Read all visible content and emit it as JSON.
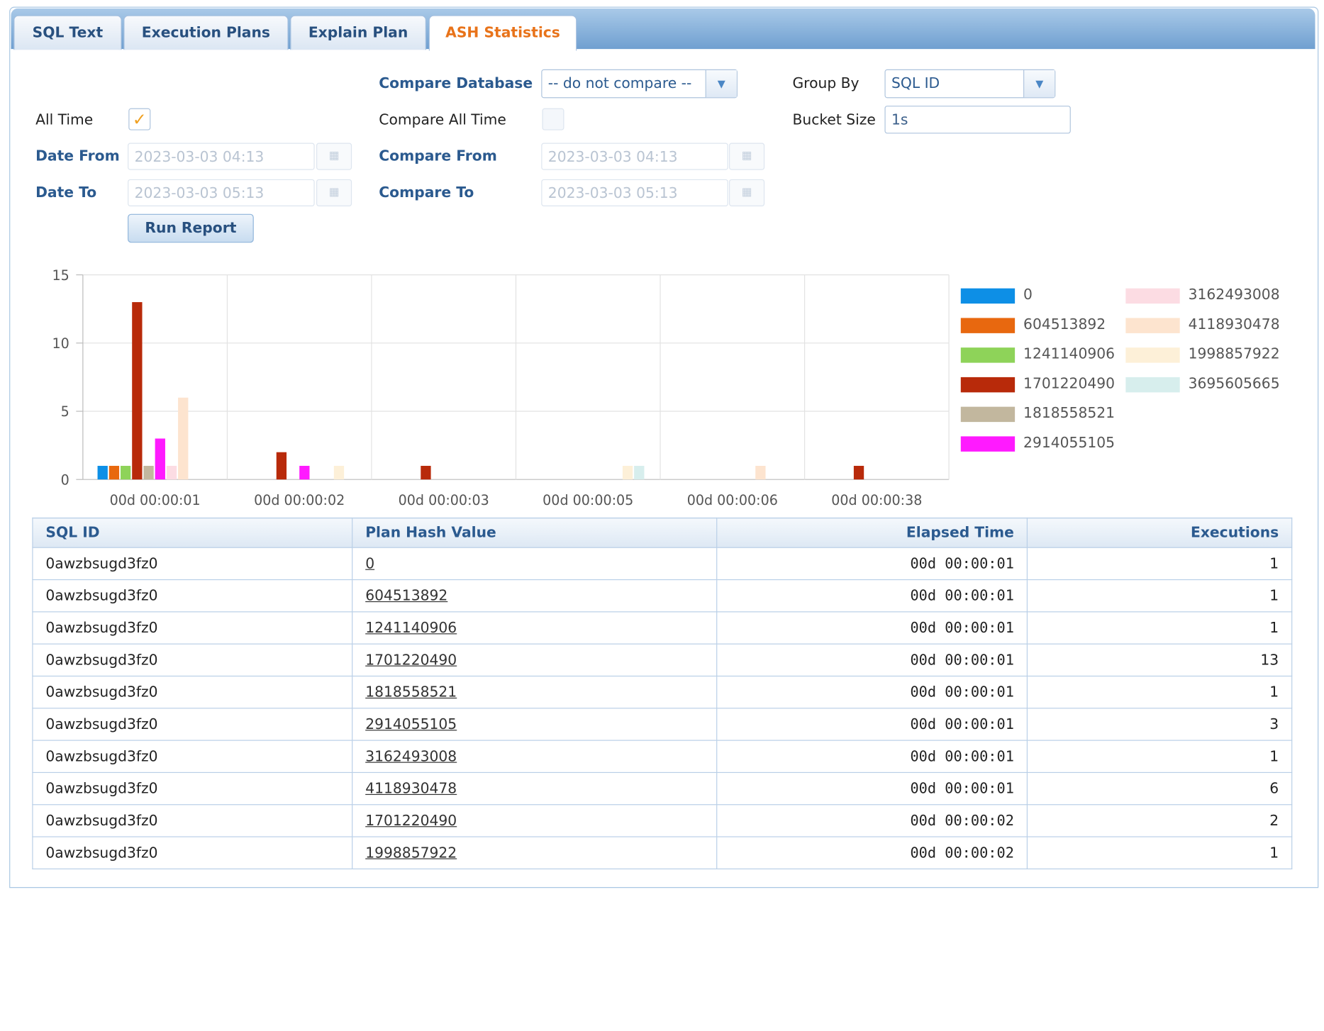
{
  "tabs": [
    {
      "label": "SQL Text"
    },
    {
      "label": "Execution Plans"
    },
    {
      "label": "Explain Plan"
    },
    {
      "label": "ASH Statistics"
    }
  ],
  "form": {
    "all_time_label": "All Time",
    "all_time_checked": true,
    "date_from_label": "Date From",
    "date_from_value": "2023-03-03 04:13",
    "date_to_label": "Date To",
    "date_to_value": "2023-03-03 05:13",
    "run_report_label": "Run Report",
    "compare_database_label": "Compare Database",
    "compare_database_value": "-- do not compare --",
    "compare_all_time_label": "Compare All Time",
    "compare_all_time_checked": false,
    "compare_from_label": "Compare From",
    "compare_from_value": "2023-03-03 04:13",
    "compare_to_label": "Compare To",
    "compare_to_value": "2023-03-03 05:13",
    "group_by_label": "Group By",
    "group_by_value": "SQL ID",
    "bucket_size_label": "Bucket Size",
    "bucket_size_value": "1s"
  },
  "chart_data": {
    "type": "bar",
    "categories": [
      "00d 00:00:01",
      "00d 00:00:02",
      "00d 00:00:03",
      "00d 00:00:05",
      "00d 00:00:06",
      "00d 00:00:38"
    ],
    "ylim": [
      0,
      15
    ],
    "yticks": [
      0,
      5,
      10,
      15
    ],
    "grid": true,
    "legend_position": "right",
    "series": [
      {
        "name": "0",
        "color": "#0d8fe6",
        "values": [
          1,
          0,
          0,
          0,
          0,
          0
        ]
      },
      {
        "name": "604513892",
        "color": "#e8680f",
        "values": [
          1,
          0,
          0,
          0,
          0,
          0
        ]
      },
      {
        "name": "1241140906",
        "color": "#8ed359",
        "values": [
          1,
          0,
          0,
          0,
          0,
          0
        ]
      },
      {
        "name": "1701220490",
        "color": "#b82a0a",
        "values": [
          13,
          2,
          1,
          0,
          0,
          1
        ]
      },
      {
        "name": "1818558521",
        "color": "#c2b79e",
        "values": [
          1,
          0,
          0,
          0,
          0,
          0
        ]
      },
      {
        "name": "2914055105",
        "color": "#ff1aff",
        "values": [
          3,
          1,
          0,
          0,
          0,
          0
        ]
      },
      {
        "name": "3162493008",
        "color": "#fcdce3",
        "values": [
          1,
          0,
          0,
          0,
          0,
          0
        ]
      },
      {
        "name": "4118930478",
        "color": "#fde4cf",
        "values": [
          6,
          0,
          0,
          0,
          1,
          0
        ]
      },
      {
        "name": "1998857922",
        "color": "#fdf0d8",
        "values": [
          0,
          1,
          0,
          1,
          0,
          0
        ]
      },
      {
        "name": "3695605665",
        "color": "#d7eeed",
        "values": [
          0,
          0,
          0,
          1,
          0,
          0
        ]
      }
    ]
  },
  "table": {
    "columns": [
      "SQL ID",
      "Plan Hash Value",
      "Elapsed Time",
      "Executions"
    ],
    "rows": [
      [
        "0awzbsugd3fz0",
        "0",
        "00d 00:00:01",
        "1"
      ],
      [
        "0awzbsugd3fz0",
        "604513892",
        "00d 00:00:01",
        "1"
      ],
      [
        "0awzbsugd3fz0",
        "1241140906",
        "00d 00:00:01",
        "1"
      ],
      [
        "0awzbsugd3fz0",
        "1701220490",
        "00d 00:00:01",
        "13"
      ],
      [
        "0awzbsugd3fz0",
        "1818558521",
        "00d 00:00:01",
        "1"
      ],
      [
        "0awzbsugd3fz0",
        "2914055105",
        "00d 00:00:01",
        "3"
      ],
      [
        "0awzbsugd3fz0",
        "3162493008",
        "00d 00:00:01",
        "1"
      ],
      [
        "0awzbsugd3fz0",
        "4118930478",
        "00d 00:00:01",
        "6"
      ],
      [
        "0awzbsugd3fz0",
        "1701220490",
        "00d 00:00:02",
        "2"
      ],
      [
        "0awzbsugd3fz0",
        "1998857922",
        "00d 00:00:02",
        "1"
      ]
    ]
  }
}
